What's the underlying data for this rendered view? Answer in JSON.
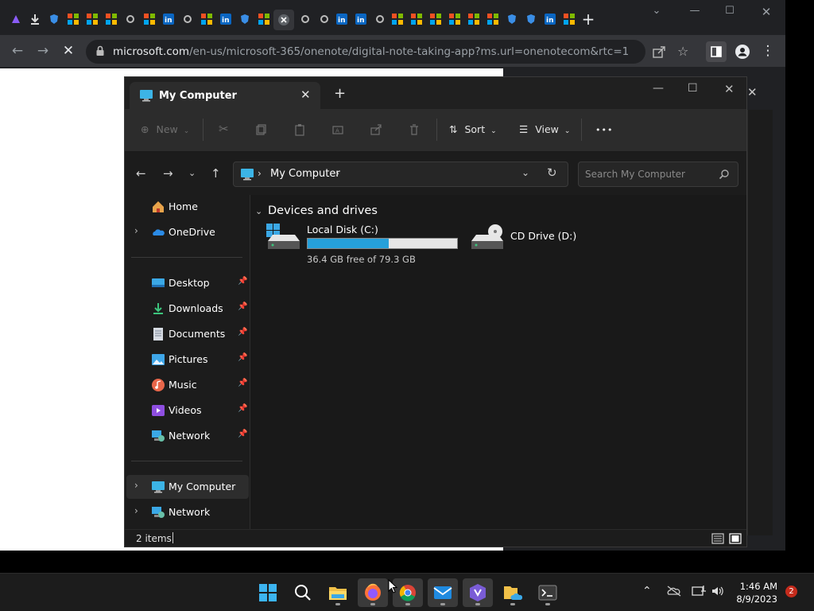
{
  "browser": {
    "url_host": "microsoft.com",
    "url_path": "/en-us/microsoft-365/onenote/digital-note-taking-app?ms.url=onenotecom&rtc=1",
    "new_tab": "+"
  },
  "explorer": {
    "tab_title": "My Computer",
    "commands": {
      "new": "New",
      "sort": "Sort",
      "view": "View",
      "more": "•••"
    },
    "address": {
      "crumb": "My Computer",
      "search_placeholder": "Search My Computer"
    },
    "sidebar": {
      "items": [
        {
          "label": "Home"
        },
        {
          "label": "OneDrive"
        },
        {
          "label": "Desktop"
        },
        {
          "label": "Downloads"
        },
        {
          "label": "Documents"
        },
        {
          "label": "Pictures"
        },
        {
          "label": "Music"
        },
        {
          "label": "Videos"
        },
        {
          "label": "Network"
        },
        {
          "label": "My Computer"
        },
        {
          "label": "Network"
        }
      ]
    },
    "main": {
      "section_title": "Devices and drives",
      "drives": [
        {
          "name": "Local Disk (C:)",
          "free_text": "36.4 GB free of 79.3 GB",
          "used_fraction": 0.54
        },
        {
          "name": "CD Drive (D:)"
        }
      ]
    },
    "status": {
      "items_text": "2 items"
    }
  },
  "taskbar": {
    "clock": {
      "time": "1:46 AM",
      "date": "8/9/2023"
    },
    "notification_count": "2"
  },
  "colors": {
    "accent": "#26a0da",
    "explorer_bg": "#191919",
    "taskbar_bg": "#1c1c1c"
  }
}
